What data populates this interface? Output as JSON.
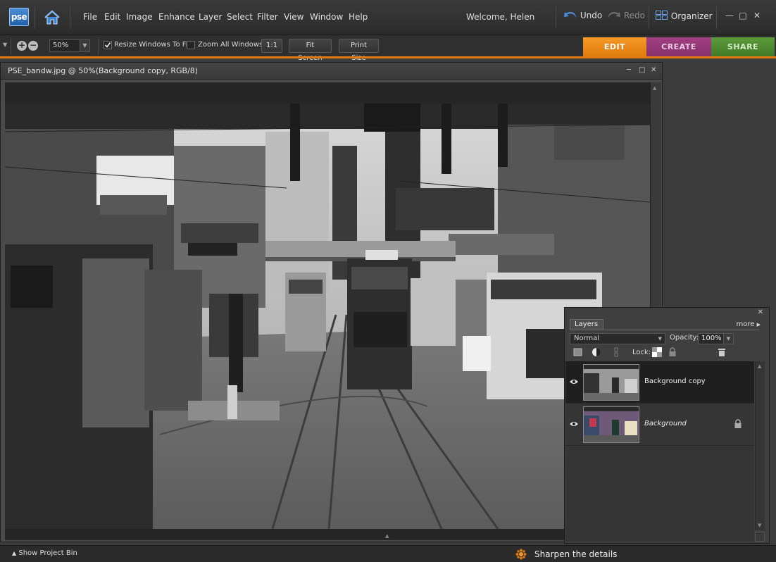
{
  "app": {
    "logo": "pse"
  },
  "menu": [
    "File",
    "Edit",
    "Image",
    "Enhance",
    "Layer",
    "Select",
    "Filter",
    "View",
    "Window",
    "Help"
  ],
  "welcome": "Welcome, Helen",
  "history": {
    "undo": "Undo",
    "redo": "Redo"
  },
  "organizer": "Organizer",
  "options": {
    "zoom_value": "50%",
    "resize_windows_label": "Resize Windows To Fit",
    "resize_windows_checked": true,
    "zoom_all_label": "Zoom All Windows",
    "zoom_all_checked": false,
    "one_to_one": "1:1",
    "fit_screen": "Fit Screen",
    "print_size": "Print Size"
  },
  "modes": {
    "edit": "EDIT",
    "create": "CREATE",
    "share": "SHARE"
  },
  "document": {
    "title": "PSE_bandw.jpg @ 50%(Background copy, RGB/8)"
  },
  "layers_panel": {
    "tab": "Layers",
    "more": "more",
    "blend_mode": "Normal",
    "opacity_label": "Opacity:",
    "opacity_value": "100%",
    "lock_label": "Lock:",
    "layers": [
      {
        "name": "Background copy",
        "selected": true,
        "locked": false
      },
      {
        "name": "Background",
        "selected": false,
        "locked": true
      }
    ]
  },
  "bottom": {
    "project_bin": "Show Project Bin",
    "tip": "Sharpen the details"
  },
  "colors": {
    "accent": "#e27b10",
    "create": "#a23f82",
    "share": "#5c9a3b"
  }
}
